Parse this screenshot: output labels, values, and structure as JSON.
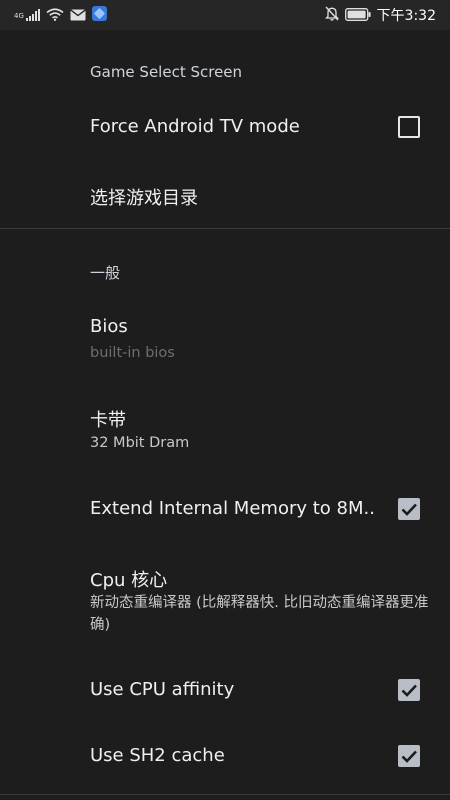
{
  "status_bar": {
    "network_type": "4G",
    "time": "下午3:32",
    "icons": [
      "signal-icon",
      "wifi-icon",
      "mail-icon",
      "app-notification-icon",
      "bell-off-icon",
      "battery-icon"
    ]
  },
  "sections": [
    {
      "header": "Game Select Screen",
      "items": [
        {
          "title": "Force Android TV mode",
          "checkbox": true,
          "checked": false
        },
        {
          "title": "选择游戏目录"
        }
      ]
    },
    {
      "header": "一般",
      "items": [
        {
          "title": "Bios",
          "summary": "built-in bios",
          "summary_disabled": true
        },
        {
          "title": "卡带",
          "summary": "32 Mbit Dram"
        },
        {
          "title": "Extend Internal Memory to 8M..",
          "checkbox": true,
          "checked": true
        },
        {
          "title": "Cpu 核心",
          "summary": "新动态重编译器 (比解释器快. 比旧动态重编译器更准确)"
        },
        {
          "title": "Use CPU affinity",
          "checkbox": true,
          "checked": true
        },
        {
          "title": "Use SH2 cache",
          "checkbox": true,
          "checked": true
        }
      ]
    }
  ],
  "colors": {
    "background": "#1d1d1d",
    "status_bar": "#262626",
    "checkbox_checked": "#b9bec6",
    "section_header": "#cfd4dc",
    "divider": "#3a3a3a"
  }
}
